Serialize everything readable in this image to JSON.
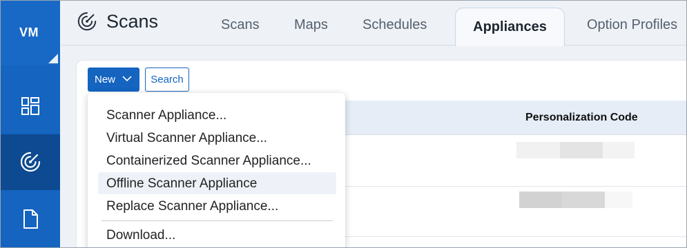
{
  "rail": {
    "logo_text": "VM",
    "items": [
      {
        "icon": "dashboard-icon",
        "active": false
      },
      {
        "icon": "scans-radar-icon",
        "active": true
      },
      {
        "icon": "document-icon",
        "active": false
      }
    ]
  },
  "header": {
    "title": "Scans",
    "title_icon": "scans-radar-icon",
    "tabs": [
      {
        "label": "Scans",
        "active": false
      },
      {
        "label": "Maps",
        "active": false
      },
      {
        "label": "Schedules",
        "active": false
      },
      {
        "label": "Appliances",
        "active": true
      },
      {
        "label": "Option Profiles",
        "active": false
      }
    ]
  },
  "toolbar": {
    "new_label": "New",
    "new_icon": "chevron-down-icon",
    "search_label": "Search"
  },
  "table": {
    "columns": [
      "Personalization Code"
    ]
  },
  "new_menu": {
    "items": [
      {
        "label": "Scanner Appliance...",
        "highlighted": false
      },
      {
        "label": "Virtual Scanner Appliance...",
        "highlighted": false
      },
      {
        "label": "Containerized Scanner Appliance...",
        "highlighted": false
      },
      {
        "label": "Offline Scanner Appliance",
        "highlighted": true
      },
      {
        "label": "Replace Scanner Appliance...",
        "highlighted": false
      },
      {
        "label": "Download...",
        "highlighted": false
      }
    ]
  },
  "colors": {
    "brand_blue": "#1464c0",
    "rail_active": "#0d4a91",
    "header_bg": "#eef2f7",
    "table_header_bg": "#e6edf7"
  }
}
